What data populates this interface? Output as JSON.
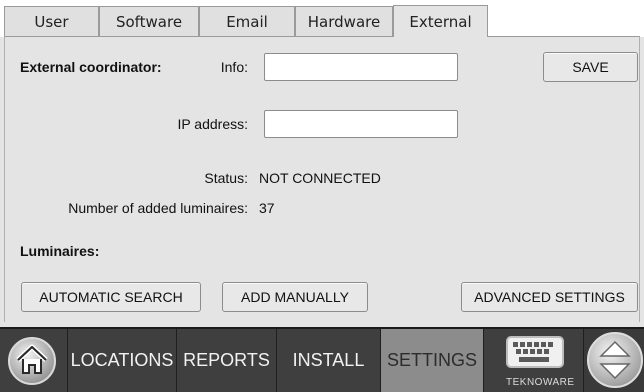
{
  "tabs": [
    {
      "label": "User"
    },
    {
      "label": "Software"
    },
    {
      "label": "Email"
    },
    {
      "label": "Hardware"
    },
    {
      "label": "External",
      "active": true
    }
  ],
  "external": {
    "section_title": "External coordinator:",
    "info_label": "Info:",
    "info_value": "",
    "ip_label": "IP address:",
    "ip_value": "",
    "save_label": "SAVE",
    "status_label": "Status:",
    "status_value": "NOT CONNECTED",
    "count_label": "Number of added luminaires:",
    "count_value": "37",
    "luminaires_title": "Luminaires:",
    "automatic_search_label": "AUTOMATIC SEARCH",
    "add_manually_label": "ADD MANUALLY",
    "advanced_settings_label": "ADVANCED SETTINGS"
  },
  "nav": {
    "items": [
      {
        "label": "LOCATIONS"
      },
      {
        "label": "REPORTS"
      },
      {
        "label": "INSTALL"
      },
      {
        "label": "SETTINGS",
        "active": true
      }
    ],
    "brand": "TEKNOWARE",
    "home_icon": "home-icon",
    "keyboard_icon": "keyboard-icon",
    "scroll_icon": "up-down-arrows-icon"
  },
  "colors": {
    "background": "#e4e4e4",
    "nav_background": "#3f3f3f",
    "nav_active": "#8c8c8c"
  }
}
